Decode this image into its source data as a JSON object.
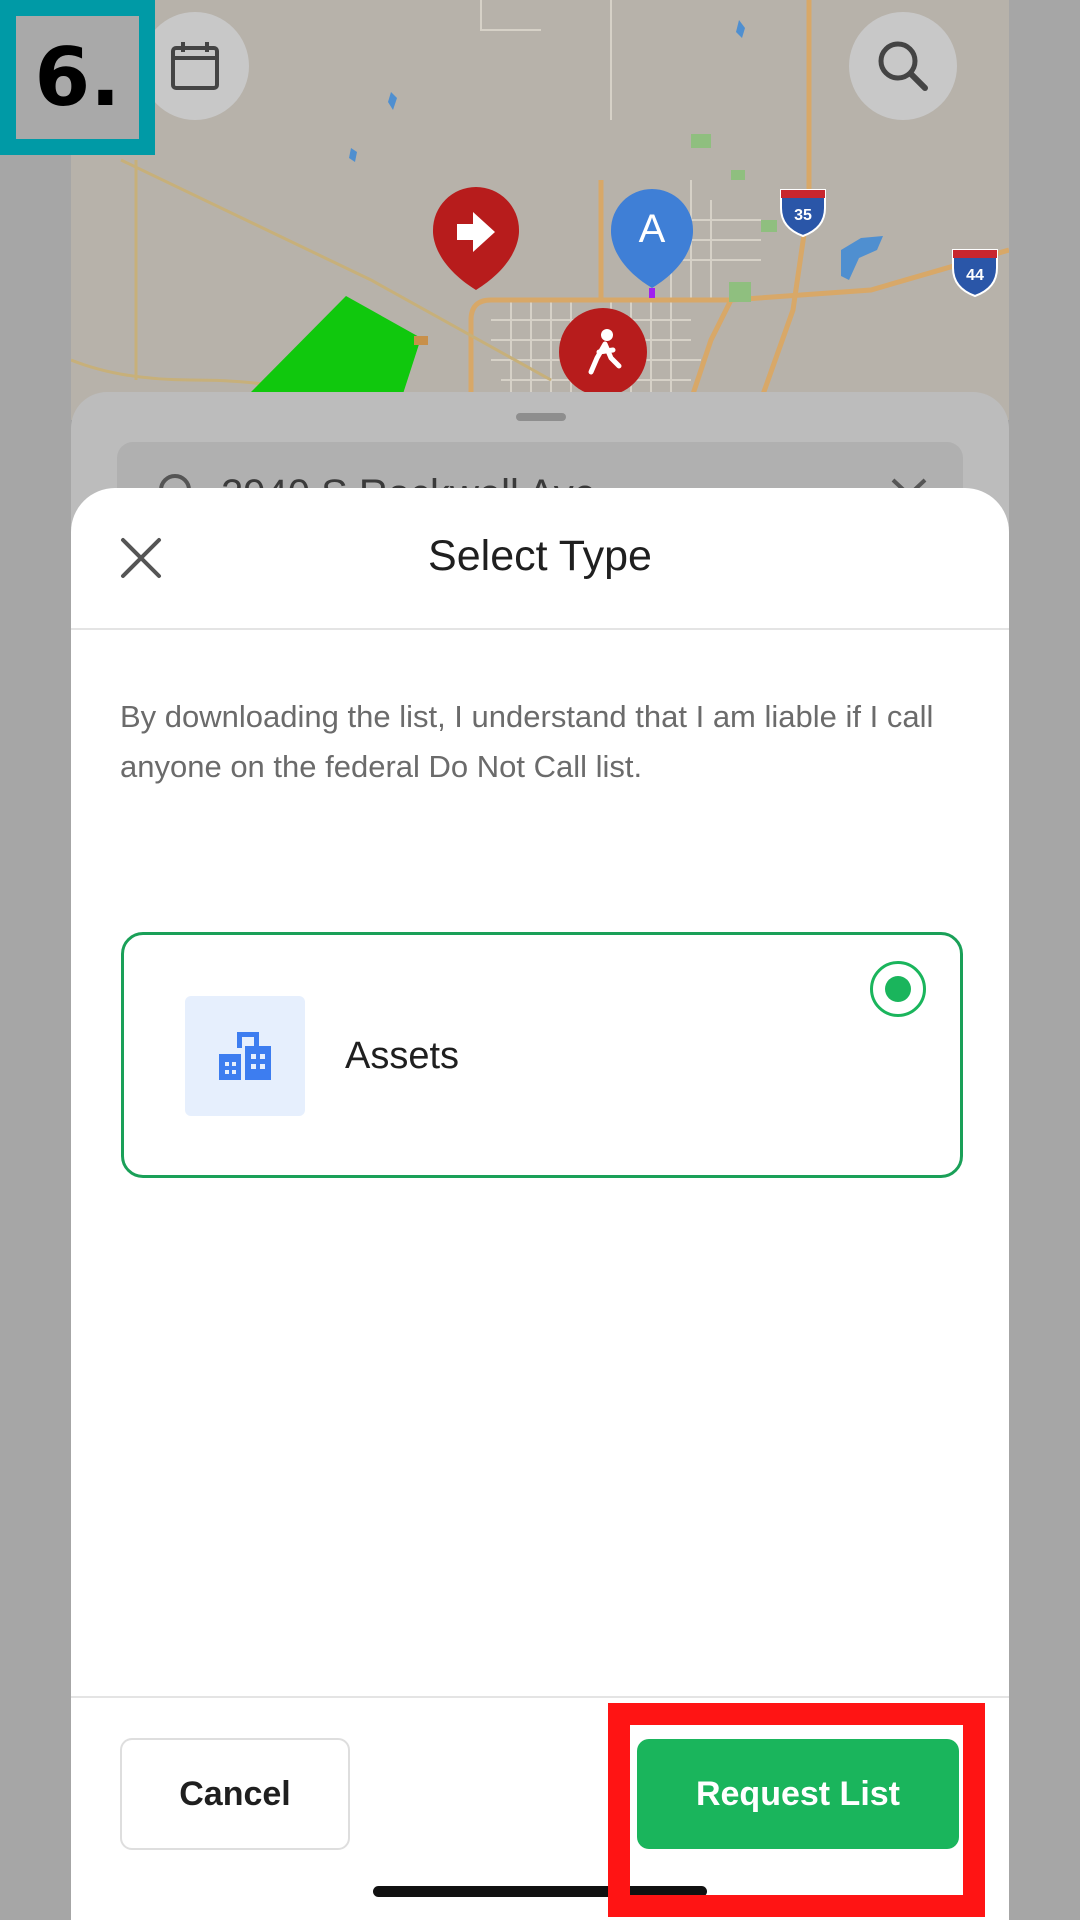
{
  "step_badge": {
    "text": "6."
  },
  "map": {
    "search_text": "2940 S Rockwell Ave",
    "highway_labels": [
      "35",
      "44"
    ],
    "pin_a_label": "A"
  },
  "modal": {
    "title": "Select Type",
    "disclaimer": "By downloading the list, I understand that I am liable if I call anyone on the federal Do Not Call list.",
    "option": {
      "label": "Assets",
      "selected": true
    }
  },
  "footer": {
    "cancel_label": "Cancel",
    "request_label": "Request List"
  },
  "colors": {
    "accent_green": "#1ab55c",
    "highlight_red": "#ff1414",
    "badge_teal": "#009aa6"
  }
}
